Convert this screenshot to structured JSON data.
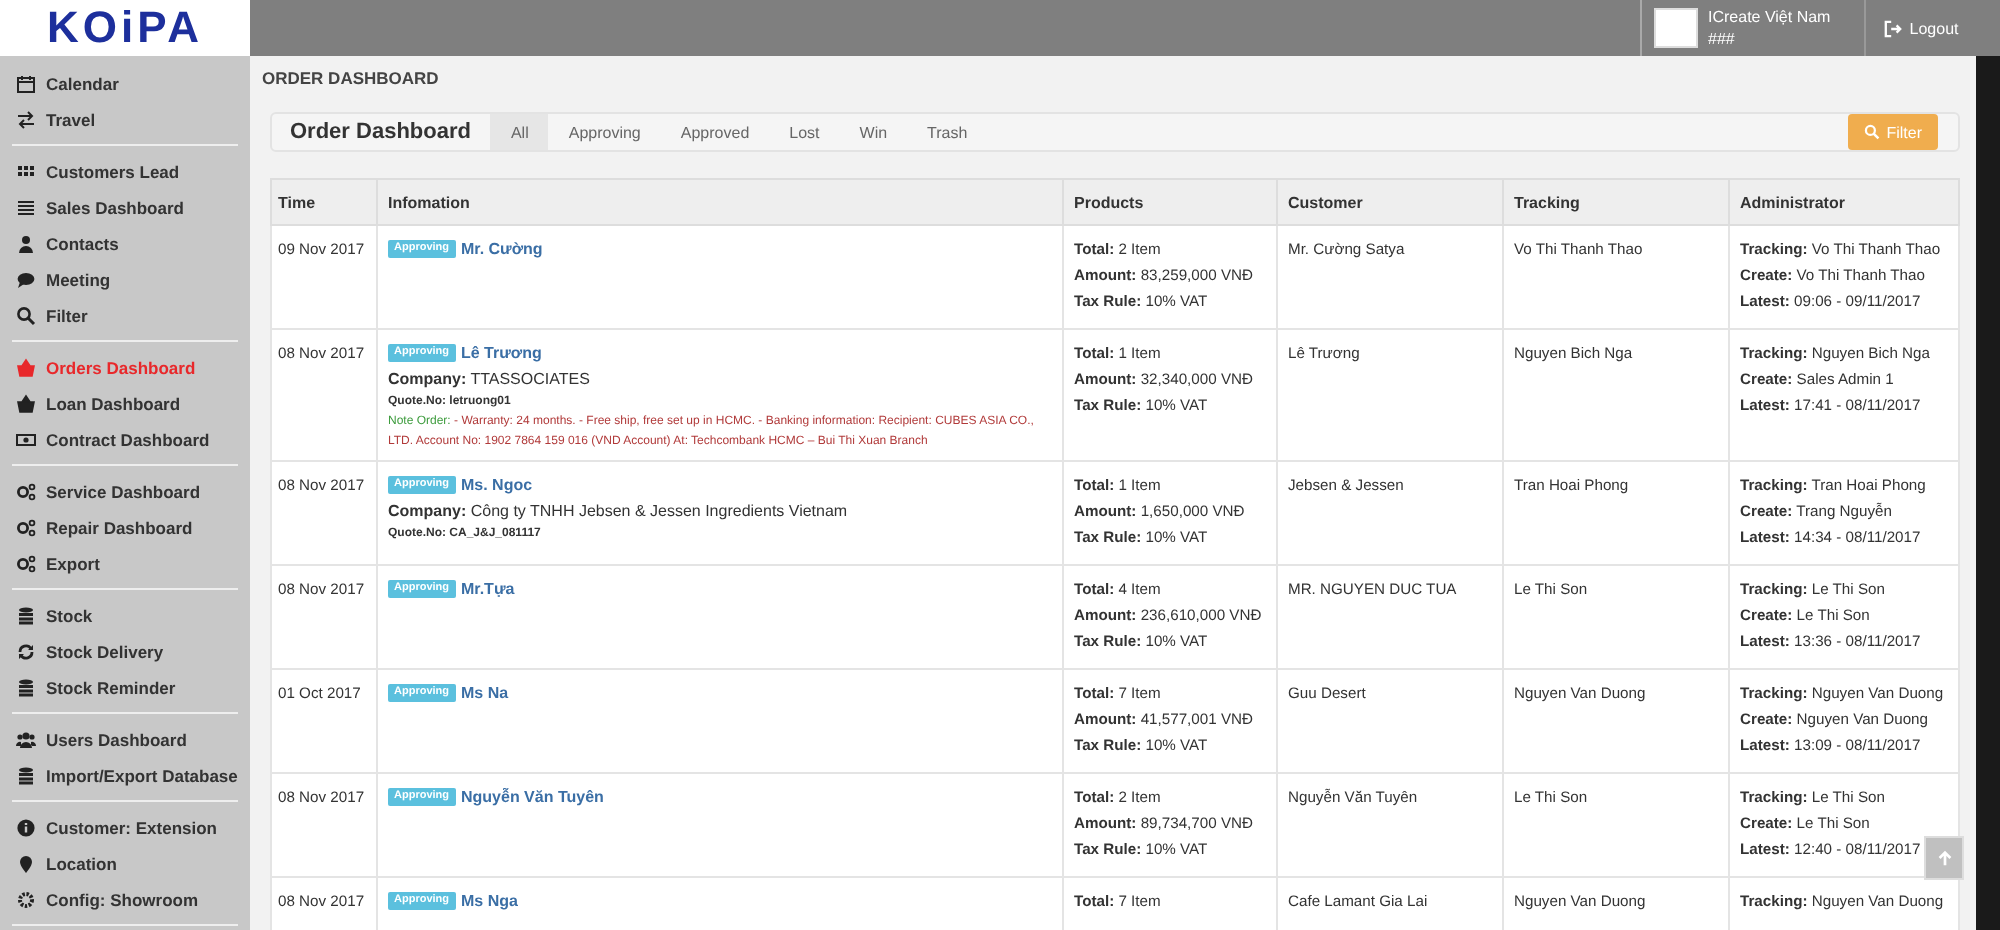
{
  "logo": {
    "text": "KOiPA"
  },
  "user": {
    "company": "ICreate Việt Nam",
    "code": "###",
    "logout": "Logout"
  },
  "sidebar": {
    "groups": [
      {
        "items": [
          {
            "label": "Calendar",
            "selected": false
          },
          {
            "label": "Travel",
            "selected": false
          }
        ]
      },
      {
        "items": [
          {
            "label": "Customers Lead",
            "selected": false
          },
          {
            "label": "Sales Dashboard",
            "selected": false
          },
          {
            "label": "Contacts",
            "selected": false
          },
          {
            "label": "Meeting",
            "selected": false
          },
          {
            "label": "Filter",
            "selected": false
          }
        ]
      },
      {
        "items": [
          {
            "label": "Orders Dashboard",
            "selected": true
          },
          {
            "label": "Loan Dashboard",
            "selected": false
          },
          {
            "label": "Contract Dashboard",
            "selected": false
          }
        ]
      },
      {
        "items": [
          {
            "label": "Service Dashboard",
            "selected": false
          },
          {
            "label": "Repair Dashboard",
            "selected": false
          },
          {
            "label": "Export",
            "selected": false
          }
        ]
      },
      {
        "items": [
          {
            "label": "Stock",
            "selected": false
          },
          {
            "label": "Stock Delivery",
            "selected": false
          },
          {
            "label": "Stock Reminder",
            "selected": false
          }
        ]
      },
      {
        "items": [
          {
            "label": "Users Dashboard",
            "selected": false
          },
          {
            "label": "Import/Export Database",
            "selected": false
          }
        ]
      },
      {
        "items": [
          {
            "label": "Customer: Extension",
            "selected": false
          },
          {
            "label": "Location",
            "selected": false
          },
          {
            "label": "Config: Showroom",
            "selected": false
          }
        ]
      }
    ]
  },
  "breadcrumb": "ORDER DASHBOARD",
  "panel": {
    "title": "Order Dashboard",
    "filter_button": "Filter",
    "tabs": [
      {
        "label": "All",
        "selected": true
      },
      {
        "label": "Approving",
        "selected": false
      },
      {
        "label": "Approved",
        "selected": false
      },
      {
        "label": "Lost",
        "selected": false
      },
      {
        "label": "Win",
        "selected": false
      },
      {
        "label": "Trash",
        "selected": false
      }
    ]
  },
  "table": {
    "columns": [
      "Time",
      "Infomation",
      "Products",
      "Customer",
      "Tracking",
      "Administrator"
    ],
    "rows": [
      {
        "time": "09 Nov 2017",
        "status": "Approving",
        "name": "Mr. Cường",
        "products": [
          "**Total:** 2 Item",
          "**Amount:** 83,259,000 VNĐ",
          "**Tax Rule:** 10% VAT"
        ],
        "customer": "Mr. Cường Satya",
        "tracking": "Vo Thi Thanh Thao",
        "admin": [
          "**Tracking:** Vo Thi Thanh Thao",
          "**Create:** Vo Thi Thanh Thao",
          "**Latest:** 09:06 - 09/11/2017"
        ]
      },
      {
        "time": "08 Nov 2017",
        "status": "Approving",
        "name": "Lê Trương",
        "company": "**Company:** TTASSOCIATES",
        "quote": "Quote.No: letruong01",
        "note": {
          "label": "Note Order:",
          "text": " - Warranty: 24 months. - Free ship, free set up in HCMC. - Banking information: Recipient: CUBES ASIA CO., LTD. Account No: 1902 7864 159 016 (VND Account) At: Techcombank HCMC – Bui Thi Xuan Branch"
        },
        "products": [
          "**Total:** 1 Item",
          "**Amount:** 32,340,000 VNĐ",
          "**Tax Rule:** 10% VAT"
        ],
        "customer": "Lê Trương",
        "tracking": "Nguyen Bich Nga",
        "admin": [
          "**Tracking:** Nguyen Bich Nga",
          "**Create:** Sales Admin 1",
          "**Latest:** 17:41 - 08/11/2017"
        ]
      },
      {
        "time": "08 Nov 2017",
        "status": "Approving",
        "name": "Ms. Ngoc",
        "company": "**Company:** Công ty TNHH Jebsen & Jessen Ingredients Vietnam",
        "quote": "Quote.No: CA_J&J_081117",
        "products": [
          "**Total:** 1 Item",
          "**Amount:** 1,650,000 VNĐ",
          "**Tax Rule:** 10% VAT"
        ],
        "customer": "Jebsen & Jessen",
        "tracking": "Tran Hoai Phong",
        "admin": [
          "**Tracking:** Tran Hoai Phong",
          "**Create:** Trang Nguyễn",
          "**Latest:** 14:34 - 08/11/2017"
        ]
      },
      {
        "time": "08 Nov 2017",
        "status": "Approving",
        "name": "Mr.Tựa",
        "products": [
          "**Total:** 4 Item",
          "**Amount:** 236,610,000 VNĐ",
          "**Tax Rule:** 10% VAT"
        ],
        "customer": "MR. NGUYEN DUC TUA",
        "tracking": "Le Thi Son",
        "admin": [
          "**Tracking:** Le Thi Son",
          "**Create:** Le Thi Son",
          "**Latest:** 13:36 - 08/11/2017"
        ]
      },
      {
        "time": "01 Oct 2017",
        "status": "Approving",
        "name": "Ms Na",
        "products": [
          "**Total:** 7 Item",
          "**Amount:** 41,577,001 VNĐ",
          "**Tax Rule:** 10% VAT"
        ],
        "customer": "Guu Desert",
        "tracking": "Nguyen Van Duong",
        "admin": [
          "**Tracking:** Nguyen Van Duong",
          "**Create:** Nguyen Van Duong",
          "**Latest:** 13:09 - 08/11/2017"
        ]
      },
      {
        "time": "08 Nov 2017",
        "status": "Approving",
        "name": "Nguyễn Văn Tuyên",
        "products": [
          "**Total:** 2 Item",
          "**Amount:** 89,734,700 VNĐ",
          "**Tax Rule:** 10% VAT"
        ],
        "customer": "Nguyễn Văn Tuyên",
        "tracking": "Le Thi Son",
        "admin": [
          "**Tracking:** Le Thi Son",
          "**Create:** Le Thi Son",
          "**Latest:** 12:40 - 08/11/2017"
        ]
      },
      {
        "time": "08 Nov 2017",
        "status": "Approving",
        "name": "Ms Nga",
        "products": [
          "**Total:** 7 Item"
        ],
        "customer": "Cafe Lamant Gia Lai",
        "tracking": "Nguyen Van Duong",
        "admin": [
          "**Tracking:** Nguyen Van Duong"
        ]
      }
    ]
  }
}
